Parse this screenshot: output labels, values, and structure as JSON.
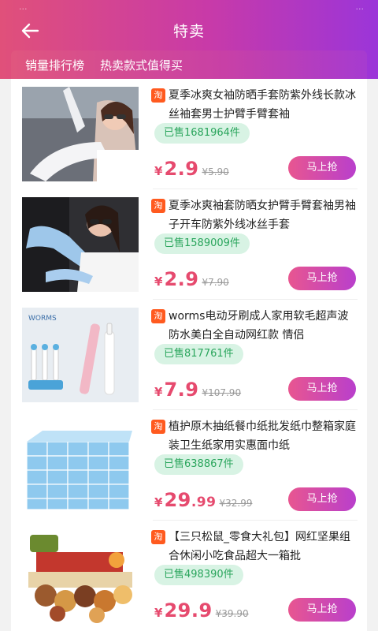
{
  "status": {
    "time": "...",
    "right": "..."
  },
  "header": {
    "title": "特卖",
    "back_icon": "arrow-left-icon"
  },
  "subtabs": [
    "销量排行榜",
    "热卖款式值得买"
  ],
  "colors": {
    "accent": "#e64a6e",
    "header_start": "#e0507a",
    "header_end": "#9b35d9",
    "sold_bg": "#d8f3e4",
    "sold_text": "#2aa55c"
  },
  "products": [
    {
      "badge": "淘",
      "title": "夏季冰爽女袖防晒手套防紫外线长款冰丝袖套男士护臂手臂套袖",
      "sold": "已售1681964件",
      "yen": "¥",
      "price": "2.9",
      "orig": "¥5.90",
      "buy": "马上抢",
      "image": "arm-sleeve-woman-photo"
    },
    {
      "badge": "淘",
      "title": "夏季冰爽袖套防晒女护臂手臂套袖男袖子开车防紫外线冰丝手套",
      "sold": "已售1589009件",
      "yen": "¥",
      "price": "2.9",
      "orig": "¥7.90",
      "buy": "马上抢",
      "image": "arm-sleeve-driving-photo"
    },
    {
      "badge": "淘",
      "title": "worms电动牙刷成人家用软毛超声波防水美白全自动网红款 情侣",
      "sold": "已售817761件",
      "yen": "¥",
      "price": "7.9",
      "orig": "¥107.90",
      "buy": "马上抢",
      "image": "electric-toothbrush-photo",
      "brand_text": "WORMS"
    },
    {
      "badge": "淘",
      "title": "植护原木抽纸餐巾纸批发纸巾整箱家庭装卫生纸家用实惠面巾纸",
      "sold": "已售638867件",
      "yen": "¥",
      "price": "29",
      "price_dec": ".99",
      "orig": "¥32.99",
      "buy": "马上抢",
      "image": "tissue-boxes-photo"
    },
    {
      "badge": "淘",
      "title": "【三只松鼠_零食大礼包】网红坚果组合休闲小吃食品超大一箱批",
      "sold": "已售498390件",
      "yen": "¥",
      "price": "29.9",
      "orig": "¥39.90",
      "buy": "马上抢",
      "image": "snack-gift-box-photo"
    }
  ]
}
